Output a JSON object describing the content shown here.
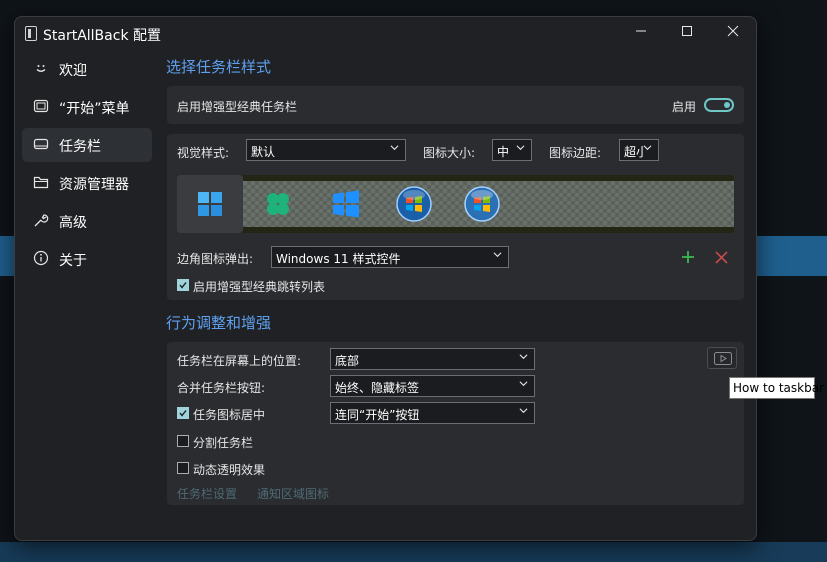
{
  "window": {
    "title": "StartAllBack 配置"
  },
  "sidebar": {
    "items": [
      {
        "label": "欢迎",
        "icon": "smile-icon"
      },
      {
        "label": "“开始”菜单",
        "icon": "start-menu-icon"
      },
      {
        "label": "任务栏",
        "icon": "taskbar-icon",
        "active": true
      },
      {
        "label": "资源管理器",
        "icon": "folder-icon"
      },
      {
        "label": "高级",
        "icon": "wrench-icon"
      },
      {
        "label": "关于",
        "icon": "info-icon"
      }
    ]
  },
  "sections": {
    "style_title": "选择任务栏样式",
    "behavior_title": "行为调整和增强"
  },
  "enhanced_taskbar": {
    "label": "启用增强型经典任务栏",
    "toggle_label": "启用",
    "enabled": true
  },
  "style_row": {
    "visual_label": "视觉样式:",
    "visual_value": "默认",
    "icon_size_label": "图标大小:",
    "icon_size_value": "中",
    "icon_margin_label": "图标边距:",
    "icon_margin_value": "超小"
  },
  "style_preview": {
    "options": [
      "windows11-start-icon",
      "clover-start-icon",
      "windows10-start-icon",
      "windows7-orb-icon",
      "vista-orb-icon"
    ],
    "selected_index": 0
  },
  "corner": {
    "label": "边角图标弹出:",
    "value": "Windows 11 样式控件"
  },
  "jumplist": {
    "label": "启用增强型经典跳转列表",
    "checked": true
  },
  "behavior": {
    "position_label": "任务栏在屏幕上的位置:",
    "position_value": "底部",
    "combine_label": "合并任务栏按钮:",
    "combine_value": "始终、隐藏标签",
    "center_label": "任务图标居中",
    "center_checked": true,
    "center_value": "连同“开始”按钮",
    "split_label": "分割任务栏",
    "split_checked": false,
    "transparent_label": "动态透明效果",
    "transparent_checked": false,
    "link_taskbar_settings": "任务栏设置",
    "link_tray_icons": "通知区域图标"
  },
  "tooltip": {
    "text": "How to taskbar"
  },
  "colors": {
    "accent": "#5ea0ef",
    "toggle": "#6fc7c7",
    "add": "#3fb950",
    "remove": "#c94a4a"
  }
}
